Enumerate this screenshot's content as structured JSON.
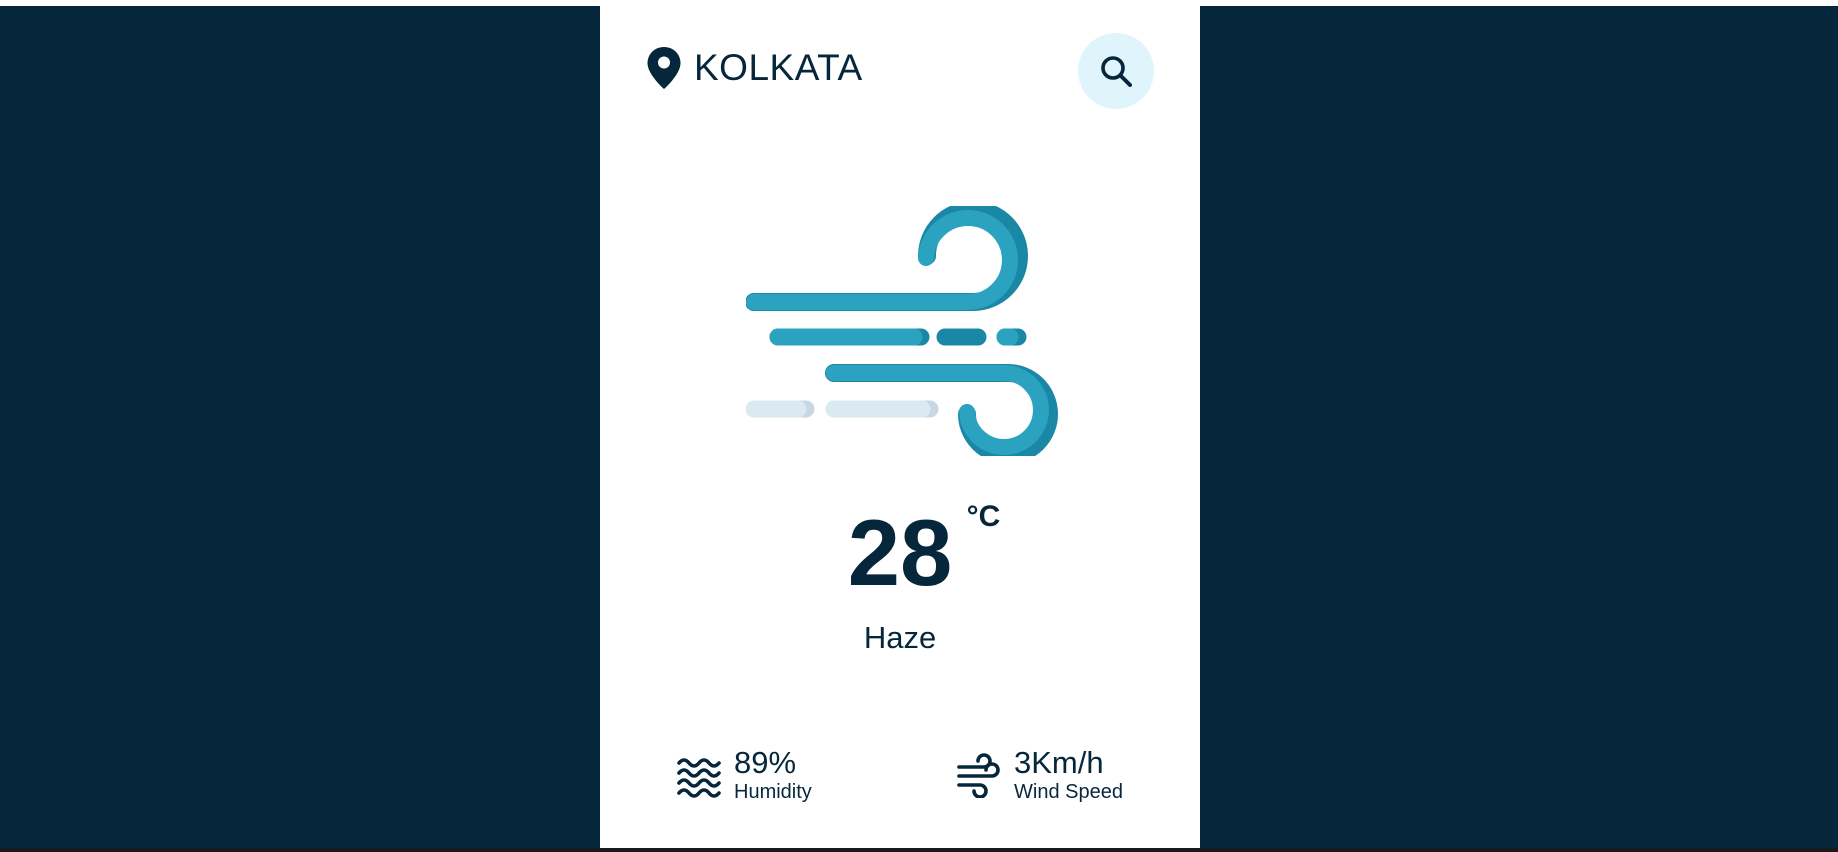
{
  "location": {
    "city": "KOLKATA",
    "pin_icon": "map-pin-icon"
  },
  "search": {
    "icon": "search-icon"
  },
  "weather": {
    "icon": "wind-haze-icon",
    "temperature": "28",
    "unit": "°C",
    "condition": "Haze"
  },
  "details": {
    "humidity": {
      "icon": "humidity-waves-icon",
      "value": "89%",
      "label": "Humidity"
    },
    "wind": {
      "icon": "wind-icon",
      "value": "3Km/h",
      "label": "Wind Speed"
    }
  },
  "colors": {
    "background": "#06263b",
    "card": "#ffffff",
    "text": "#06263b",
    "accent": "#2ba2c0",
    "accent_dark": "#1b87a6",
    "search_bg": "#e0f4fc",
    "faded": "#dbe9f0"
  }
}
